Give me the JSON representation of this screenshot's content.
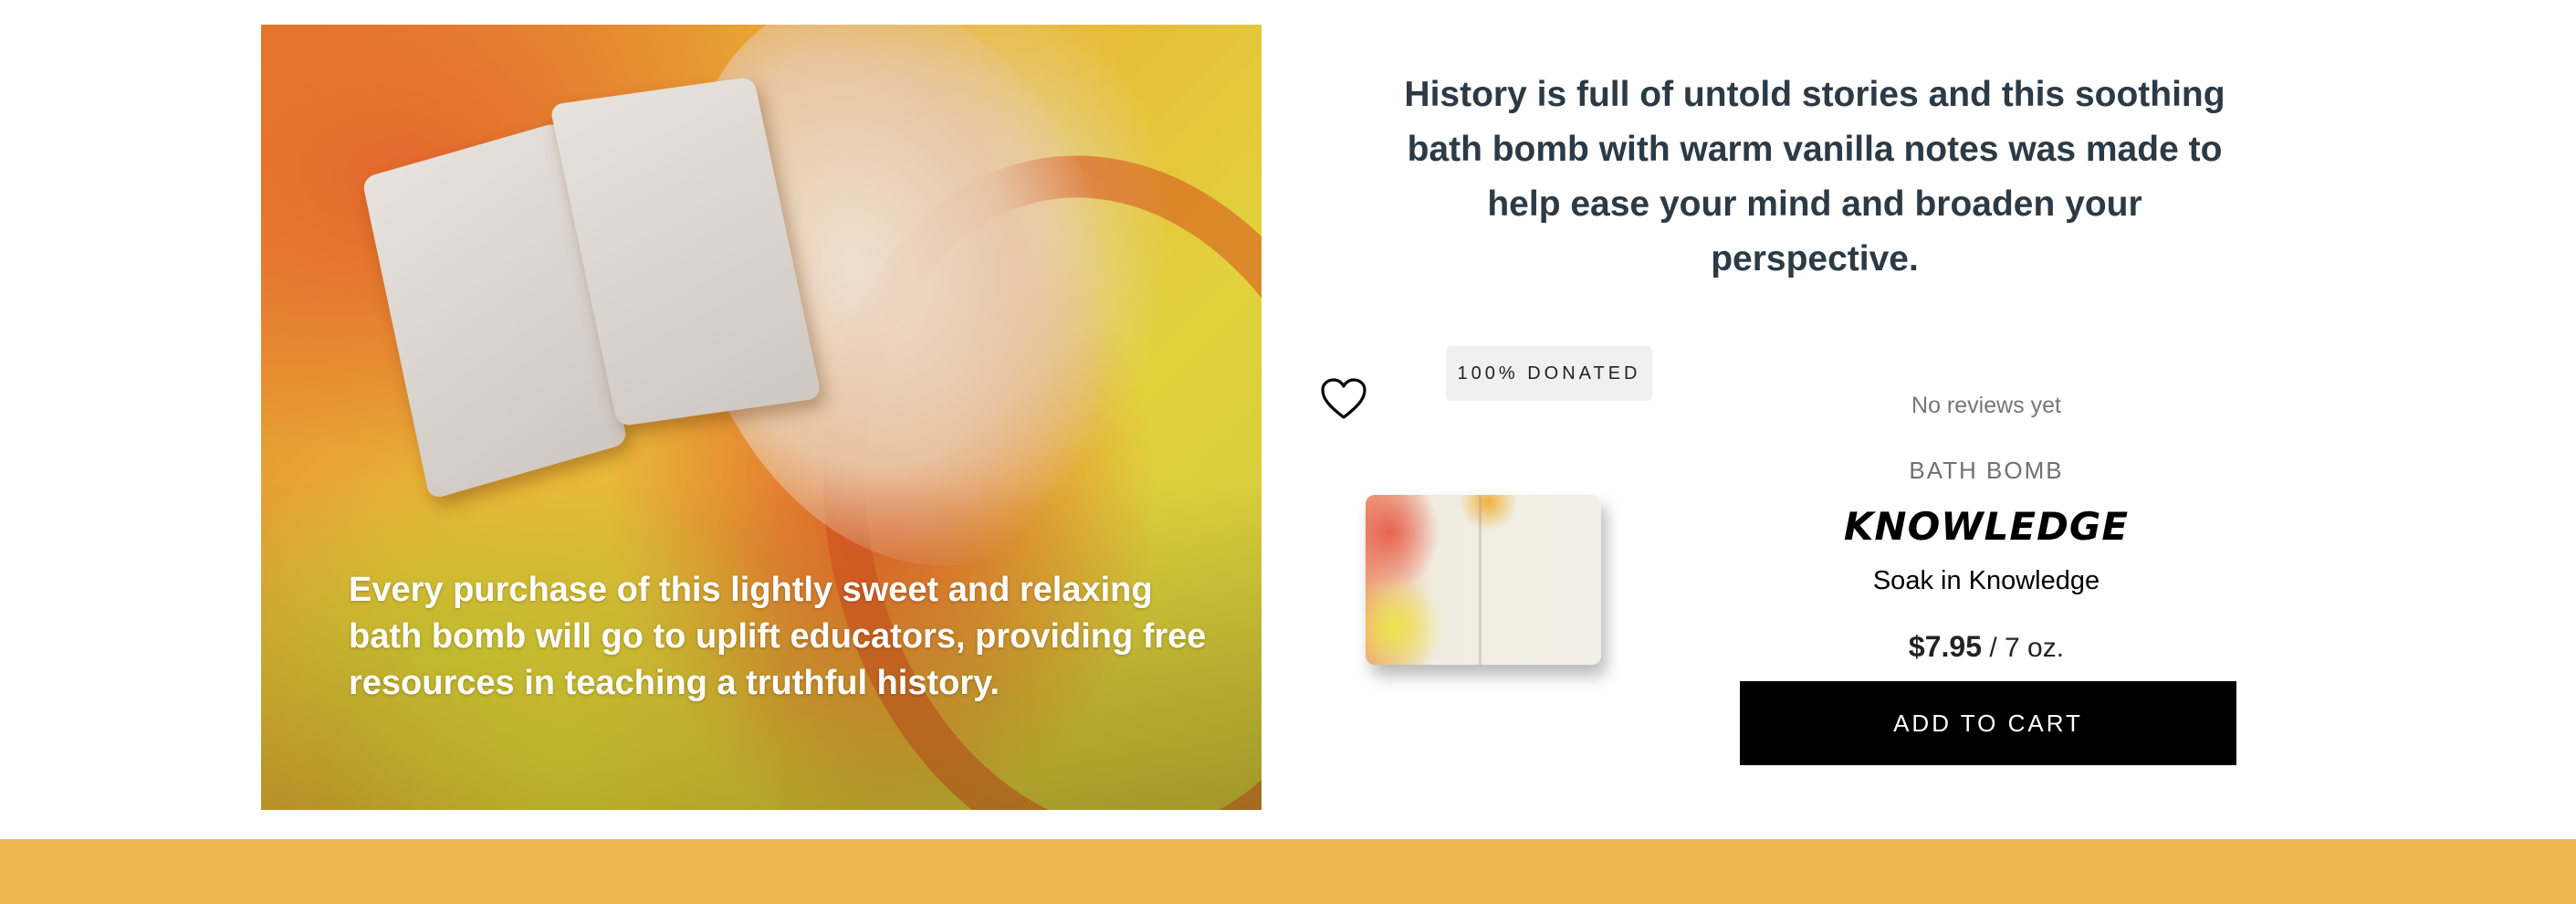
{
  "hero": {
    "text": "Every purchase of this lightly sweet and relaxing bath bomb will go to uplift educators, providing free resources in teaching a truthful history."
  },
  "description": "History is full of untold stories and this soothing bath bomb with warm vanilla notes was made to help ease your mind and broaden your perspective.",
  "product": {
    "badge": "100% DONATED",
    "reviews": "No reviews yet",
    "category": "BATH BOMB",
    "name": "KNOWLEDGE",
    "tagline": "Soak in Knowledge",
    "price": "$7.95",
    "size": "/ 7 oz.",
    "add_to_cart_label": "ADD TO CART",
    "wishlist_icon": "heart-outline-icon"
  },
  "colors": {
    "band": "#f0b652",
    "button_bg": "#000000",
    "heading": "#2c3a45"
  }
}
